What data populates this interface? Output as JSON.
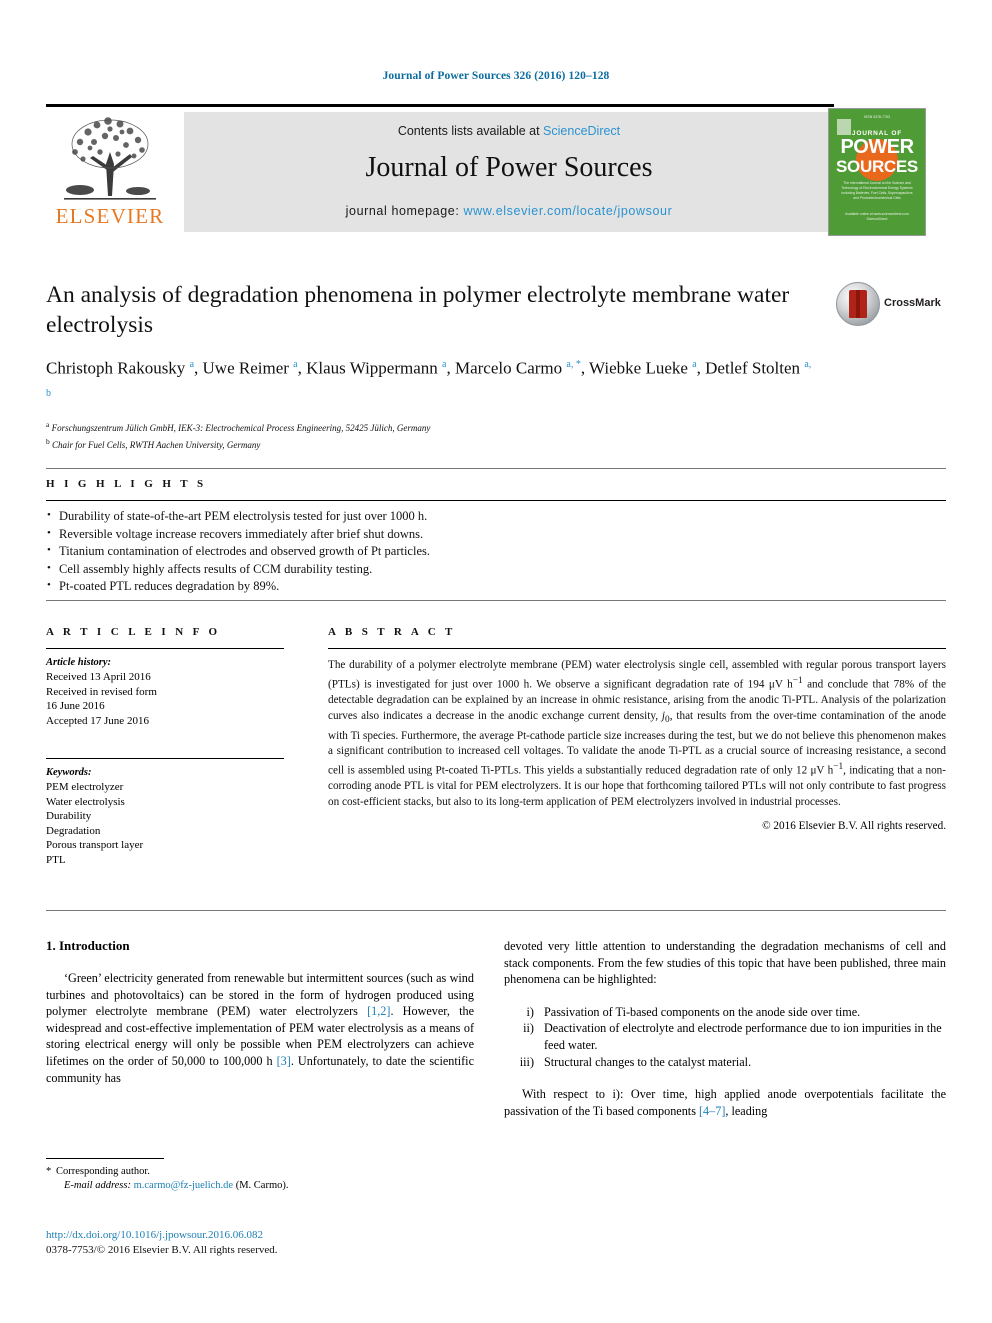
{
  "running_head": "Journal of Power Sources 326 (2016) 120–128",
  "masthead": {
    "contents_prefix": "Contents lists available at ",
    "contents_link": "ScienceDirect",
    "journal_title": "Journal of Power Sources",
    "homepage_prefix": "journal homepage: ",
    "homepage_url": "www.elsevier.com/locate/jpowsour",
    "publisher_name": "ELSEVIER",
    "cover": {
      "top_label": "ISSN 0378-7753",
      "journal_of": "JOURNAL OF",
      "power": "POWER",
      "sources": "SOURCES",
      "blurb": "The International Journal on the Science and Technology of Electrochemical Energy Systems including Batteries, Fuel Cells, Supercapacitors and Photoelectrochemical Cells",
      "foot": "Available online at www.sciencedirect.com ScienceDirect"
    }
  },
  "article": {
    "title": "An analysis of degradation phenomena in polymer electrolyte membrane water electrolysis",
    "crossmark_label": "CrossMark",
    "authors_html": "Christoph Rakousky <sup>a</sup>, Uwe Reimer <sup>a</sup>, Klaus Wippermann <sup>a</sup>, Marcelo Carmo <sup>a, *</sup>, Wiebke Lueke <sup>a</sup>, Detlef Stolten <sup>a, b</sup>",
    "affiliations": [
      {
        "marker": "a",
        "text": "Forschungszentrum Jülich GmbH, IEK-3: Electrochemical Process Engineering, 52425 Jülich, Germany"
      },
      {
        "marker": "b",
        "text": "Chair for Fuel Cells, RWTH Aachen University, Germany"
      }
    ]
  },
  "highlights": {
    "heading": "H I G H L I G H T S",
    "items": [
      "Durability of state-of-the-art PEM electrolysis tested for just over 1000 h.",
      "Reversible voltage increase recovers immediately after brief shut downs.",
      "Titanium contamination of electrodes and observed growth of Pt particles.",
      "Cell assembly highly affects results of CCM durability testing.",
      "Pt-coated PTL reduces degradation by 89%."
    ]
  },
  "article_info": {
    "heading": "A R T I C L E   I N F O",
    "history_label": "Article history:",
    "history": [
      "Received 13 April 2016",
      "Received in revised form",
      "16 June 2016",
      "Accepted 17 June 2016"
    ],
    "keywords_label": "Keywords:",
    "keywords": [
      "PEM electrolyzer",
      "Water electrolysis",
      "Durability",
      "Degradation",
      "Porous transport layer",
      "PTL"
    ]
  },
  "abstract": {
    "heading": "A B S T R A C T",
    "body_html": "The durability of a polymer electrolyte membrane (PEM) water electrolysis single cell, assembled with regular porous transport layers (PTLs) is investigated for just over 1000 h. We observe a significant degradation rate of 194 μV h<sup>&minus;1</sup> and conclude that 78% of the detectable degradation can be explained by an increase in ohmic resistance, arising from the anodic Ti-PTL. Analysis of the polarization curves also indicates a decrease in the anodic exchange current density, <i>j</i><sub>0</sub>, that results from the over-time contamination of the anode with Ti species. Furthermore, the average Pt-cathode particle size increases during the test, but we do not believe this phenomenon makes a significant contribution to increased cell voltages. To validate the anode Ti-PTL as a crucial source of increasing resistance, a second cell is assembled using Pt-coated Ti-PTLs. This yields a substantially reduced degradation rate of only 12 μV h<sup>&minus;1</sup>, indicating that a non-corroding anode PTL is vital for PEM electrolyzers. It is our hope that forthcoming tailored PTLs will not only contribute to fast progress on cost-efficient stacks, but also to its long-term application of PEM electrolyzers involved in industrial processes.",
    "copyright": "© 2016 Elsevier B.V. All rights reserved."
  },
  "body": {
    "section_number_title": "1. Introduction",
    "left_paragraph_html": "&lsquo;Green&rsquo; electricity generated from renewable but intermittent sources (such as wind turbines and photovoltaics) can be stored in the form of hydrogen produced using polymer electrolyte membrane (PEM) water electrolyzers <span class=\"ref\">[1,2]</span>. However, the widespread and cost-effective implementation of PEM water electrolysis as a means of storing electrical energy will only be possible when PEM electrolyzers can achieve lifetimes on the order of 50,000 to 100,000 h <span class=\"ref\">[3]</span>. Unfortunately, to date the scientific community has",
    "right_paragraph_html": "devoted very little attention to understanding the degradation mechanisms of cell and stack components. From the few studies of this topic that have been published, three main phenomena can be highlighted:",
    "roman_items": [
      {
        "marker": "i)",
        "text": "Passivation of Ti-based components on the anode side over time."
      },
      {
        "marker": "ii)",
        "text": "Deactivation of electrolyte and electrode performance due to ion impurities in the feed water."
      },
      {
        "marker": "iii)",
        "text": "Structural changes to the catalyst material."
      }
    ],
    "right_paragraph2_html": "With respect to i): Over time, high applied anode overpotentials facilitate the passivation of the Ti based components <span class=\"ref\">[4&ndash;7]</span>, leading"
  },
  "footer": {
    "corresponding_star": "*",
    "corresponding_author": "Corresponding author.",
    "email_label": "E-mail address:",
    "email": "m.carmo@fz-juelich.de",
    "email_suffix": "(M. Carmo).",
    "doi": "http://dx.doi.org/10.1016/j.jpowsour.2016.06.082",
    "issn_line": "0378-7753/© 2016 Elsevier B.V. All rights reserved."
  },
  "colors": {
    "link_blue": "#1d7fb5",
    "header_blue": "#0b6ca0",
    "elsevier_orange": "#e87722",
    "cover_green": "#4f9b36",
    "cover_orange": "#e8681c"
  }
}
